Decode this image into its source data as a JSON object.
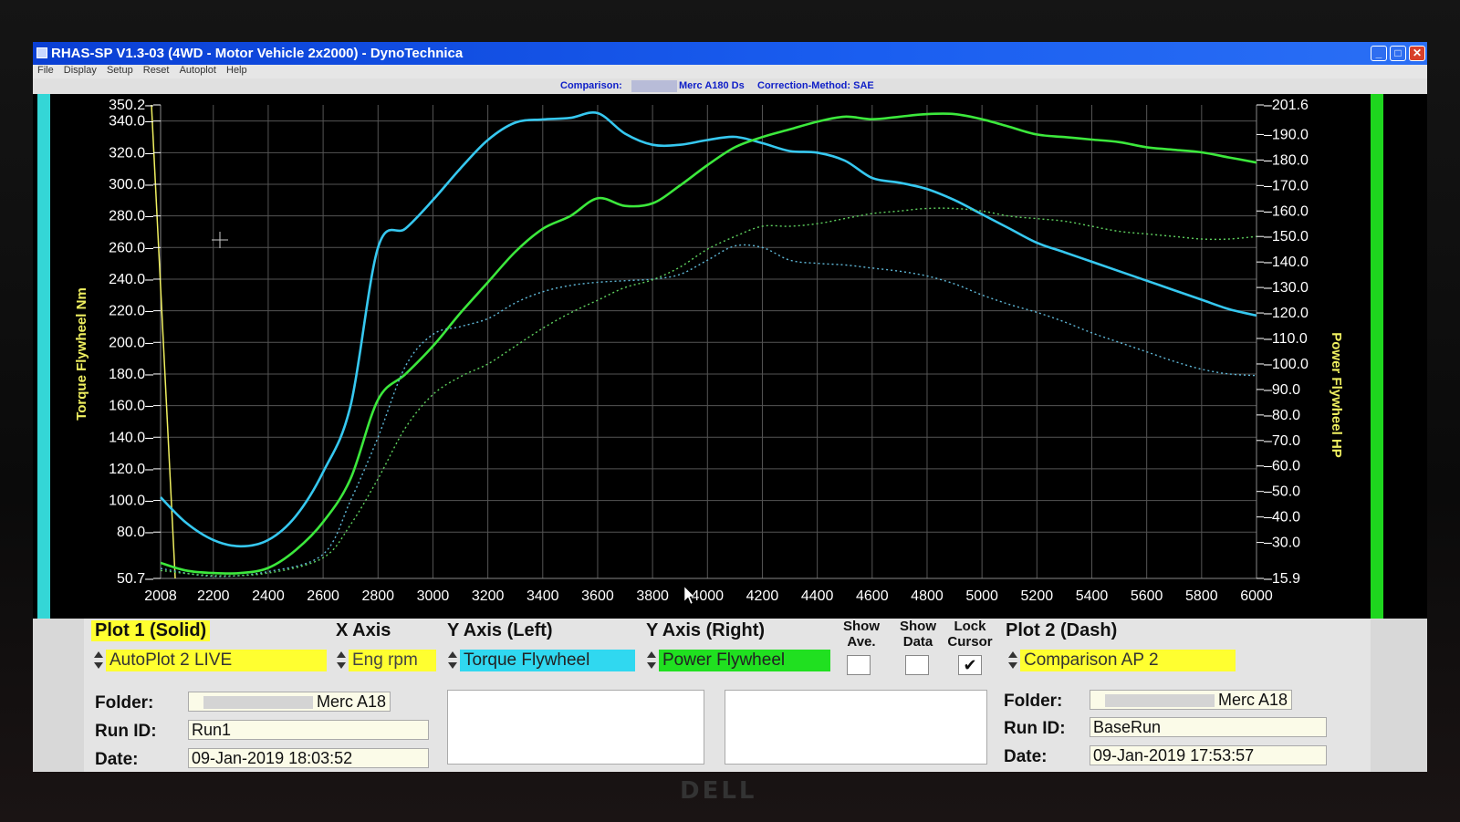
{
  "window": {
    "title": "RHAS-SP V1.3-03  (4WD - Motor Vehicle 2x2000) - DynoTechnica",
    "min_icon": "minimize-icon",
    "max_icon": "maximize-icon",
    "close_icon": "close-icon"
  },
  "menu": [
    "File",
    "Display",
    "Setup",
    "Reset",
    "Autoplot",
    "Help"
  ],
  "comparison_bar": {
    "label": "Comparison:",
    "name": "Merc A180 Ds",
    "method": "Correction-Method: SAE"
  },
  "chart_data": {
    "type": "line",
    "xlabel": "",
    "ylabel_left": "Torque Flywheel Nm",
    "ylabel_right": "Power Flywheel HP",
    "xlim": [
      2008,
      6000
    ],
    "ylim_left": [
      50.7,
      350.2
    ],
    "ylim_right": [
      15.9,
      201.6
    ],
    "x_ticks": [
      "2008",
      "2200",
      "2400",
      "2600",
      "2800",
      "3000",
      "3200",
      "3400",
      "3600",
      "3800",
      "4000",
      "4200",
      "4400",
      "4600",
      "4800",
      "5000",
      "5200",
      "5400",
      "5600",
      "5800",
      "6000"
    ],
    "y_ticks_left": [
      "350.2",
      "340.0",
      "320.0",
      "300.0",
      "280.0",
      "260.0",
      "240.0",
      "220.0",
      "200.0",
      "180.0",
      "160.0",
      "140.0",
      "120.0",
      "100.0",
      "80.0",
      "50.7"
    ],
    "y_ticks_right": [
      "201.6",
      "190.0",
      "180.0",
      "170.0",
      "160.0",
      "150.0",
      "140.0",
      "130.0",
      "120.0",
      "110.0",
      "100.0",
      "90.0",
      "80.0",
      "70.0",
      "60.0",
      "50.0",
      "40.0",
      "30.0",
      "15.9"
    ],
    "grid": true,
    "series": [
      {
        "axis": "left",
        "color": "#36c8f0",
        "style": "solid",
        "points": [
          [
            2008,
            102
          ],
          [
            2100,
            86
          ],
          [
            2200,
            75
          ],
          [
            2300,
            71
          ],
          [
            2400,
            75
          ],
          [
            2500,
            90
          ],
          [
            2600,
            118
          ],
          [
            2700,
            160
          ],
          [
            2800,
            260
          ],
          [
            2900,
            272
          ],
          [
            3000,
            290
          ],
          [
            3100,
            310
          ],
          [
            3200,
            328
          ],
          [
            3300,
            339
          ],
          [
            3400,
            341
          ],
          [
            3500,
            342
          ],
          [
            3600,
            345
          ],
          [
            3700,
            332
          ],
          [
            3800,
            325
          ],
          [
            3900,
            325
          ],
          [
            4000,
            328
          ],
          [
            4100,
            330
          ],
          [
            4200,
            326
          ],
          [
            4300,
            321
          ],
          [
            4400,
            320
          ],
          [
            4500,
            315
          ],
          [
            4600,
            304
          ],
          [
            4700,
            301
          ],
          [
            4800,
            297
          ],
          [
            4900,
            290
          ],
          [
            5000,
            281
          ],
          [
            5100,
            272
          ],
          [
            5200,
            263
          ],
          [
            5300,
            257
          ],
          [
            5400,
            251
          ],
          [
            5500,
            245
          ],
          [
            5600,
            239
          ],
          [
            5700,
            233
          ],
          [
            5800,
            227
          ],
          [
            5900,
            221
          ],
          [
            6000,
            217
          ]
        ]
      },
      {
        "axis": "right",
        "color": "#3ce83c",
        "style": "solid",
        "points": [
          [
            2008,
            22
          ],
          [
            2100,
            19
          ],
          [
            2200,
            18
          ],
          [
            2300,
            18
          ],
          [
            2400,
            20
          ],
          [
            2500,
            27
          ],
          [
            2600,
            38
          ],
          [
            2700,
            55
          ],
          [
            2800,
            86
          ],
          [
            2900,
            96
          ],
          [
            3000,
            107
          ],
          [
            3100,
            120
          ],
          [
            3200,
            132
          ],
          [
            3300,
            144
          ],
          [
            3400,
            153
          ],
          [
            3500,
            158
          ],
          [
            3600,
            165
          ],
          [
            3700,
            162
          ],
          [
            3800,
            163
          ],
          [
            3900,
            170
          ],
          [
            4000,
            178
          ],
          [
            4100,
            185
          ],
          [
            4200,
            189
          ],
          [
            4300,
            192
          ],
          [
            4400,
            195
          ],
          [
            4500,
            197
          ],
          [
            4600,
            196
          ],
          [
            4700,
            197
          ],
          [
            4800,
            198
          ],
          [
            4900,
            198
          ],
          [
            5000,
            196
          ],
          [
            5100,
            193
          ],
          [
            5200,
            190
          ],
          [
            5300,
            189
          ],
          [
            5400,
            188
          ],
          [
            5500,
            187
          ],
          [
            5600,
            185
          ],
          [
            5700,
            184
          ],
          [
            5800,
            183
          ],
          [
            5900,
            181
          ],
          [
            6000,
            179
          ]
        ]
      },
      {
        "axis": "left",
        "color": "#5fb8d8",
        "style": "dotted",
        "points": [
          [
            2008,
            57
          ],
          [
            2200,
            52
          ],
          [
            2400,
            55
          ],
          [
            2600,
            66
          ],
          [
            2700,
            100
          ],
          [
            2800,
            140
          ],
          [
            2900,
            185
          ],
          [
            3000,
            205
          ],
          [
            3100,
            210
          ],
          [
            3200,
            215
          ],
          [
            3300,
            225
          ],
          [
            3400,
            232
          ],
          [
            3500,
            236
          ],
          [
            3600,
            238
          ],
          [
            3700,
            239
          ],
          [
            3800,
            240
          ],
          [
            3900,
            243
          ],
          [
            4000,
            252
          ],
          [
            4100,
            261
          ],
          [
            4200,
            260
          ],
          [
            4300,
            252
          ],
          [
            4400,
            250
          ],
          [
            4500,
            249
          ],
          [
            4600,
            247
          ],
          [
            4700,
            245
          ],
          [
            4800,
            242
          ],
          [
            4900,
            237
          ],
          [
            5000,
            230
          ],
          [
            5100,
            224
          ],
          [
            5200,
            219
          ],
          [
            5300,
            213
          ],
          [
            5400,
            206
          ],
          [
            5500,
            200
          ],
          [
            5600,
            194
          ],
          [
            5700,
            188
          ],
          [
            5800,
            183
          ],
          [
            5900,
            180
          ],
          [
            6000,
            179
          ]
        ]
      },
      {
        "axis": "right",
        "color": "#5fd25f",
        "style": "dotted",
        "points": [
          [
            2008,
            19
          ],
          [
            2200,
            17
          ],
          [
            2400,
            18
          ],
          [
            2600,
            24
          ],
          [
            2700,
            37
          ],
          [
            2800,
            55
          ],
          [
            2900,
            75
          ],
          [
            3000,
            88
          ],
          [
            3100,
            95
          ],
          [
            3200,
            100
          ],
          [
            3300,
            107
          ],
          [
            3400,
            114
          ],
          [
            3500,
            120
          ],
          [
            3600,
            125
          ],
          [
            3700,
            130
          ],
          [
            3800,
            133
          ],
          [
            3900,
            138
          ],
          [
            4000,
            145
          ],
          [
            4100,
            150
          ],
          [
            4200,
            154
          ],
          [
            4300,
            154
          ],
          [
            4400,
            155
          ],
          [
            4500,
            157
          ],
          [
            4600,
            159
          ],
          [
            4700,
            160
          ],
          [
            4800,
            161
          ],
          [
            4900,
            161
          ],
          [
            5000,
            160
          ],
          [
            5100,
            158
          ],
          [
            5200,
            157
          ],
          [
            5300,
            156
          ],
          [
            5400,
            154
          ],
          [
            5500,
            152
          ],
          [
            5600,
            151
          ],
          [
            5700,
            150
          ],
          [
            5800,
            149
          ],
          [
            5900,
            149
          ],
          [
            6000,
            150
          ]
        ]
      }
    ]
  },
  "panel": {
    "plot1_header": "Plot 1 (Solid)",
    "xaxis_header": "X Axis",
    "yleft_header": "Y Axis (Left)",
    "yright_header": "Y Axis (Right)",
    "show_ave": "Show\nAve.",
    "show_data": "Show\nData",
    "lock_cursor": "Lock\nCursor",
    "plot2_header": "Plot 2 (Dash)",
    "plot1_select": "AutoPlot 2 LIVE",
    "xaxis_select": "Eng rpm",
    "yleft_select": "Torque Flywheel",
    "yright_select": "Power Flywheel",
    "plot2_select": "Comparison AP 2",
    "show_ave_checked": false,
    "show_data_checked": false,
    "lock_cursor_checked": true,
    "check_mark": "✔",
    "folder_label": "Folder:",
    "runid_label": "Run ID:",
    "date_label": "Date:",
    "plot1_folder": "Merc A18",
    "plot1_runid": "Run1",
    "plot1_date": "09-Jan-2019  18:03:52",
    "plot2_folder": "Merc A18",
    "plot2_runid": "BaseRun",
    "plot2_date": "09-Jan-2019  17:53:57"
  },
  "monitor_brand": "DELL",
  "colors": {
    "titlebar": "#1a5ef0",
    "highlight_yellow": "#ffff30",
    "torque_cyan": "#36c8f0",
    "power_green": "#3ce83c",
    "axis_yellow": "#f0f060"
  }
}
